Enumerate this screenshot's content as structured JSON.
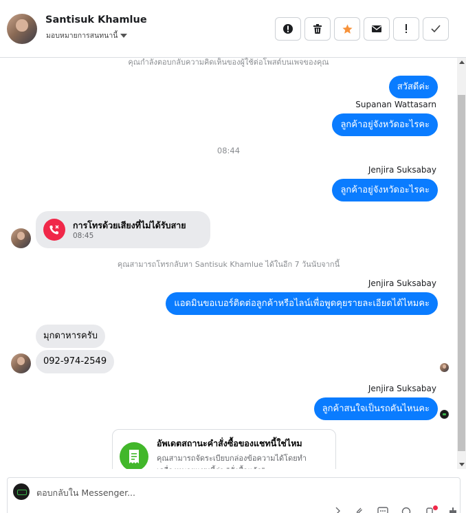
{
  "header": {
    "contact_name": "Santisuk Khamlue",
    "assign_label": "มอบหมายการสนทนานี้",
    "actions": [
      {
        "name": "report-button",
        "icon": "alert-circle-icon"
      },
      {
        "name": "delete-button",
        "icon": "trash-icon"
      },
      {
        "name": "star-button",
        "icon": "star-icon",
        "color": "#f7923a"
      },
      {
        "name": "mark-unread-button",
        "icon": "envelope-icon"
      },
      {
        "name": "follow-up-button",
        "icon": "exclamation-icon"
      },
      {
        "name": "mark-done-button",
        "icon": "check-icon"
      }
    ]
  },
  "conversation": {
    "top_notice": "คุณกำลังตอบกลับความคิดเห็นของผู้ใช้ต่อโพสต์บนเพจของคุณ",
    "msg_greeting": "สวัสดีค่ะ",
    "sender_1": "Supanan Wattasarn",
    "msg_province_1": "ลูกค้าอยู่จังหวัดอะไรคะ",
    "timestamp": "08:44",
    "sender_2": "Jenjira Suksabay",
    "msg_province_2": "ลูกค้าอยู่จังหวัดอะไรคะ",
    "missed_call": {
      "title": "การโทรด้วยเสียงที่ไม่ได้รับสาย",
      "time": "08:45"
    },
    "callback_notice": "คุณสามารถโทรกลับหา Santisuk Khamlue ได้ในอีก 7 วันนับจากนี้",
    "sender_3": "Jenjira Suksabay",
    "msg_ask_phone": "แอดมินขอเบอร์ติดต่อลูกค้าหรือไลน์เพื่อพูดคุยรายละเอียดได้ไหมคะ",
    "msg_in_1": "มุกดาหารครับ",
    "msg_in_2": "092-974-2549",
    "sender_4": "Jenjira Suksabay",
    "msg_which_car": "ลูกค้าสนใจเป็นรถคันไหนคะ",
    "card": {
      "title": "อัพเดตสถานะคำสั่งซื้อของแชทนี้ใช่ไหม",
      "body": "คุณสามารถจัดระเบียบกล่องข้อความได้โดยทำเครื่องหมายแชทนี้ว่า \"สั่งซื้อแล้ว\""
    }
  },
  "composer": {
    "placeholder": "ตอบกลับใน Messenger...",
    "value": ""
  },
  "colors": {
    "outgoing_bubble": "#0a7cff",
    "incoming_bubble": "#e9eaed",
    "missed_call_icon": "#f02849",
    "card_icon": "#42b72a"
  }
}
